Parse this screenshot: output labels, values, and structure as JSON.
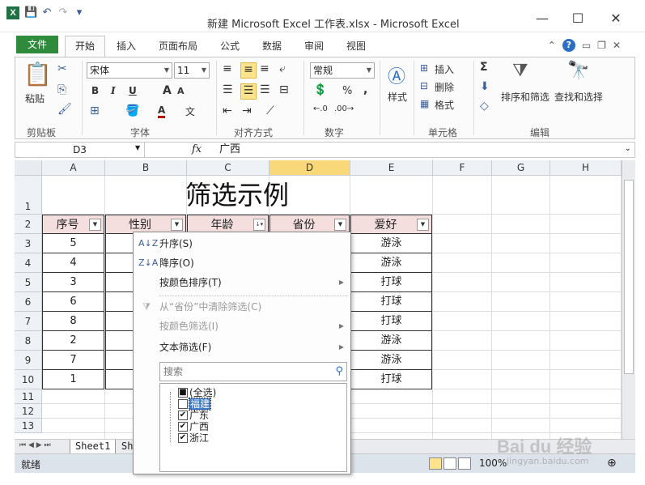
{
  "window": {
    "app_icon": "X",
    "title": "新建 Microsoft Excel 工作表.xlsx - Microsoft Excel",
    "minimize": "—",
    "restore": "☐",
    "close": "✕"
  },
  "qat": {
    "save": "💾",
    "undo": "↶",
    "redo": "↷",
    "customize": "▾"
  },
  "tabs": {
    "file": "文件",
    "active": "开始",
    "items": [
      "插入",
      "页面布局",
      "公式",
      "数据",
      "审阅",
      "视图"
    ]
  },
  "ribbon": {
    "clipboard": {
      "label": "剪贴板",
      "paste": "粘贴"
    },
    "font": {
      "label": "字体",
      "font_name": "宋体",
      "font_size": "11",
      "bold": "B",
      "italic": "I",
      "underline": "U",
      "grow": "A",
      "shrink": "A",
      "font_color": "A"
    },
    "alignment": {
      "label": "对齐方式"
    },
    "number": {
      "label": "数字",
      "format": "常规",
      "percent": "%",
      "comma": ","
    },
    "styles": {
      "label": "样式"
    },
    "cells": {
      "label": "单元格",
      "insert": "插入",
      "delete": "删除",
      "format": "格式"
    },
    "editing": {
      "label": "编辑",
      "sort_filter": "排序和筛选",
      "find_select": "查找和选择",
      "sum": "Σ"
    }
  },
  "formula_bar": {
    "name_box": "D3",
    "fx": "fx",
    "value": "广西"
  },
  "sheet": {
    "columns": [
      "A",
      "B",
      "C",
      "D",
      "E",
      "F",
      "G",
      "H"
    ],
    "rows": [
      "1",
      "2",
      "3",
      "4",
      "5",
      "6",
      "7",
      "8",
      "9",
      "10",
      "11",
      "12",
      "13"
    ],
    "title": "筛选示例",
    "headers": [
      "序号",
      "性别",
      "年龄",
      "省份",
      "爱好"
    ],
    "col_a": [
      "5",
      "4",
      "3",
      "6",
      "8",
      "2",
      "7",
      "1"
    ],
    "col_e": [
      "游泳",
      "游泳",
      "打球",
      "打球",
      "打球",
      "游泳",
      "游泳",
      "打球"
    ],
    "active_column": "D"
  },
  "filter_menu": {
    "sort_asc": "升序(S)",
    "sort_desc": "降序(O)",
    "sort_by_color": "按颜色排序(T)",
    "clear_filter": "从“省份”中清除筛选(C)",
    "filter_by_color": "按颜色筛选(I)",
    "text_filter": "文本筛选(F)",
    "search_placeholder": "搜索",
    "items": [
      {
        "label": "(全选)",
        "state": "■"
      },
      {
        "label": "福建",
        "state": ""
      },
      {
        "label": "广东",
        "state": "✔"
      },
      {
        "label": "广西",
        "state": "✔"
      },
      {
        "label": "浙江",
        "state": "✔"
      }
    ]
  },
  "sheet_tabs": {
    "active": "Sheet1",
    "next": "Sh"
  },
  "status": {
    "ready": "就绪",
    "zoom": "100%"
  },
  "watermark": {
    "text": "Bai du 经验",
    "sub": "jingyan.baidu.com"
  }
}
